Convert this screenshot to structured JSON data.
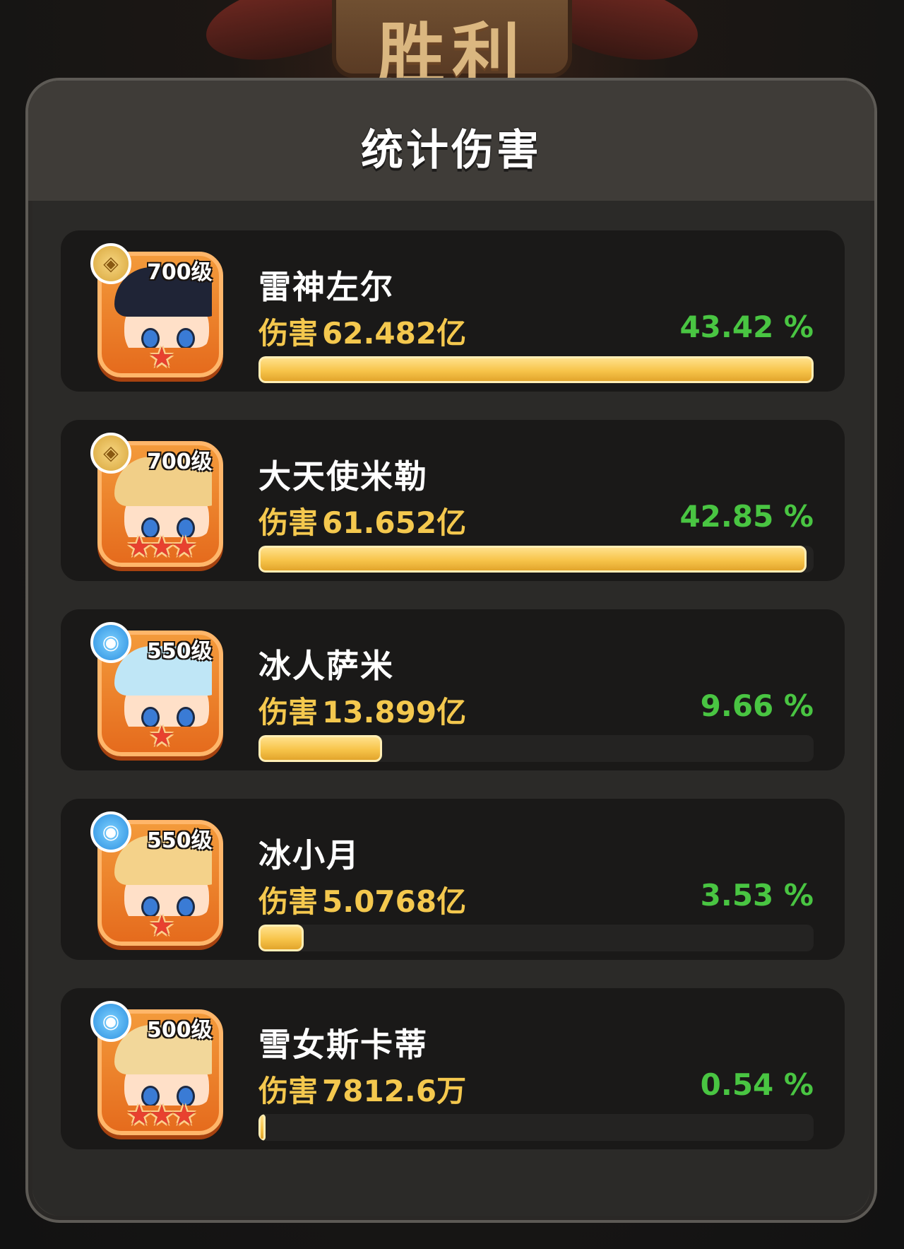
{
  "banner": {
    "text": "胜利"
  },
  "panel": {
    "title": "统计伤害"
  },
  "labels": {
    "damage": "伤害"
  },
  "colors": {
    "damage_text": "#f4c84e",
    "percent_text": "#49c542",
    "bar_fill": "#f7c44a",
    "portrait_frame": "#e56b1d"
  },
  "heroes": [
    {
      "name": "雷神左尔",
      "level": "700级",
      "element": "gold",
      "element_icon": "rune-icon",
      "stars": "★",
      "damage": "62.482亿",
      "percent": "43.42 %",
      "share": 0.4342,
      "hair_color": "#1f2436"
    },
    {
      "name": "大天使米勒",
      "level": "700级",
      "element": "gold",
      "element_icon": "rune-icon",
      "stars": "★★★",
      "damage": "61.652亿",
      "percent": "42.85 %",
      "share": 0.4285,
      "hair_color": "#f1cf88"
    },
    {
      "name": "冰人萨米",
      "level": "550级",
      "element": "ice",
      "element_icon": "water-drop-icon",
      "stars": "★",
      "damage": "13.899亿",
      "percent": "9.66 %",
      "share": 0.0966,
      "hair_color": "#bfe6f6"
    },
    {
      "name": "冰小月",
      "level": "550级",
      "element": "ice",
      "element_icon": "water-drop-icon",
      "stars": "★",
      "damage": "5.0768亿",
      "percent": "3.53 %",
      "share": 0.0353,
      "hair_color": "#f4d28a"
    },
    {
      "name": "雪女斯卡蒂",
      "level": "500级",
      "element": "ice",
      "element_icon": "water-drop-icon",
      "stars": "★★★",
      "damage": "7812.6万",
      "percent": "0.54 %",
      "share": 0.0054,
      "hair_color": "#f2d79a"
    }
  ]
}
